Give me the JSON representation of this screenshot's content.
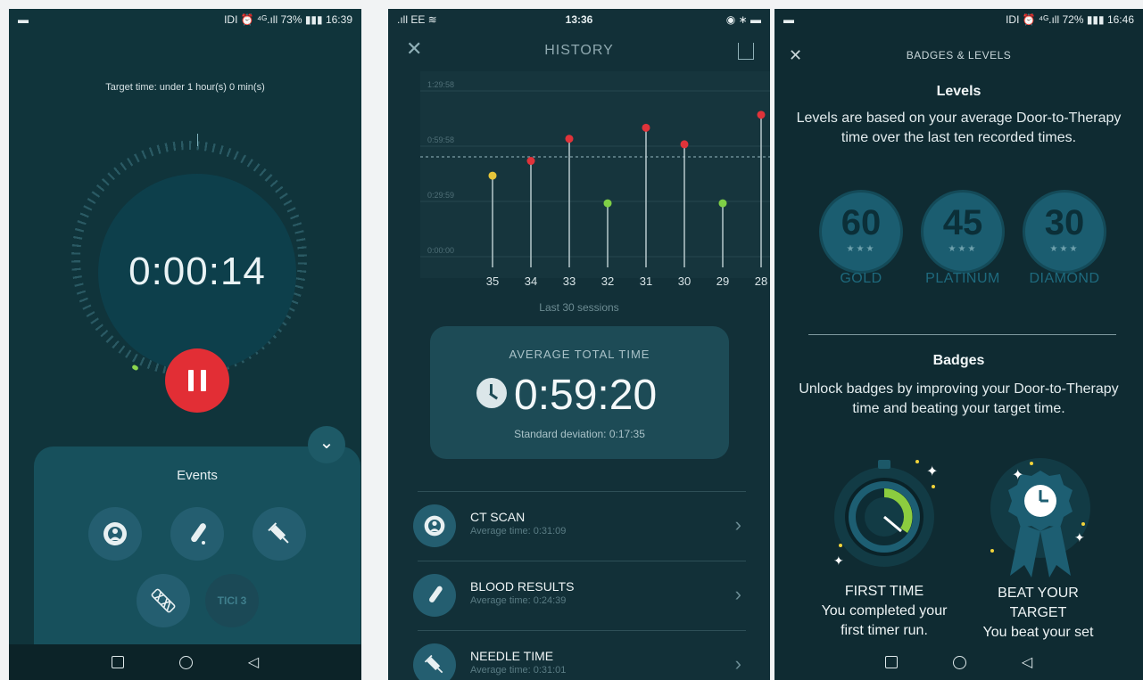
{
  "screen1": {
    "status": {
      "left": "▬",
      "right": "IDI ⏰ ⁴ᴳ.ıll 73% ▮▮▮ 16:39"
    },
    "target_text": "Target time: under 1 hour(s) 0 min(s)",
    "timer": "0:00:14",
    "events_title": "Events",
    "tici_label": "TICI 3"
  },
  "screen2": {
    "status": {
      "left": ".ıll EE ≋",
      "center": "13:36",
      "right": "◉ ∗ ▬"
    },
    "title": "HISTORY",
    "chart_data": {
      "type": "scatter",
      "categories": [
        "35",
        "34",
        "33",
        "32",
        "31",
        "30",
        "29",
        "28"
      ],
      "values_minutes": [
        44,
        52,
        64,
        29,
        70,
        61,
        29,
        77
      ],
      "point_colors": [
        "#e6c53a",
        "#e0333a",
        "#e0333a",
        "#7fcf46",
        "#e0333a",
        "#e0333a",
        "#7fcf46",
        "#e0333a"
      ],
      "ytick_labels": [
        "0:00:00",
        "0:29:59",
        "0:59:58",
        "1:29:58"
      ],
      "ytick_values_minutes": [
        0,
        30,
        60,
        90
      ],
      "target_minutes": 60,
      "ylim": [
        0,
        90
      ]
    },
    "sessions_label": "Last 30 sessions",
    "avg_label": "AVERAGE TOTAL TIME",
    "avg_time": "0:59:20",
    "std_dev": "Standard deviation: 0:17:35",
    "rows": [
      {
        "name": "CT SCAN",
        "sub": "Average time: 0:31:09"
      },
      {
        "name": "BLOOD RESULTS",
        "sub": "Average time: 0:24:39"
      },
      {
        "name": "NEEDLE TIME",
        "sub": "Average time: 0:31:01"
      }
    ]
  },
  "screen3": {
    "status": {
      "left": "▬",
      "right": "IDI ⏰ ⁴ᴳ.ıll 72% ▮▮▮ 16:46"
    },
    "title": "BADGES & LEVELS",
    "levels_heading": "Levels",
    "levels_text": "Levels are based on your average Door-to-Therapy time over the last ten recorded times.",
    "levels": [
      {
        "num": "60",
        "name": "GOLD"
      },
      {
        "num": "45",
        "name": "PLATINUM"
      },
      {
        "num": "30",
        "name": "DIAMOND"
      }
    ],
    "badges_heading": "Badges",
    "badges_text": "Unlock badges by improving your Door-to-Therapy time and beating your target time.",
    "badges": [
      {
        "title": "FIRST TIME",
        "desc": "You completed your first timer run."
      },
      {
        "title": "BEAT YOUR TARGET",
        "desc": "You beat your set"
      }
    ]
  }
}
